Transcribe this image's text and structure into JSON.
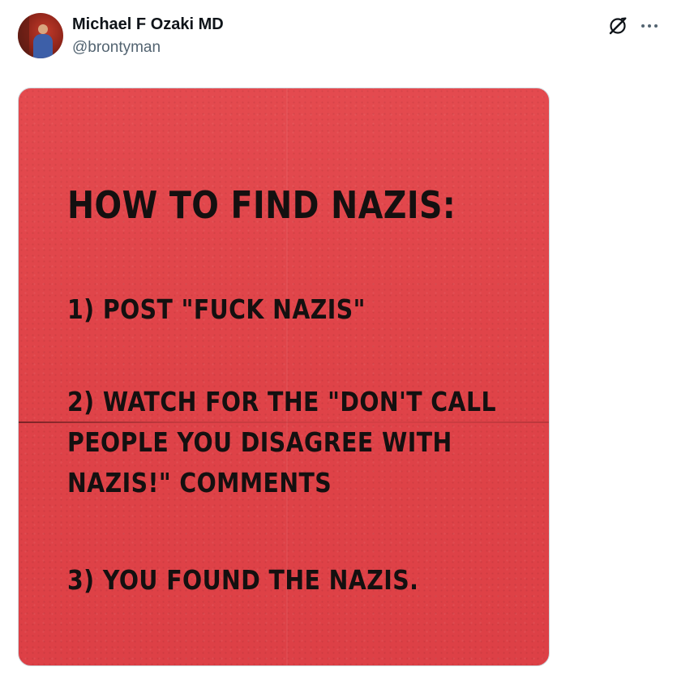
{
  "author": {
    "display_name": "Michael F Ozaki MD",
    "handle": "@brontyman"
  },
  "icons": {
    "grok": "grok-icon",
    "more": "more-options-icon"
  },
  "media": {
    "background_color": "#e1454a",
    "text_color": "#141010",
    "title": "HOW TO FIND NAZiS:",
    "steps": [
      "1) POST \"FUCK NAZIS\"",
      "2) WATCH FOR THE \"DON'T CALL",
      "PEOPLE YOU DiSAGREE WiTH",
      "NAZiS!\" COMMENTS",
      "3) YOU FOUND THE NAZIS."
    ]
  }
}
